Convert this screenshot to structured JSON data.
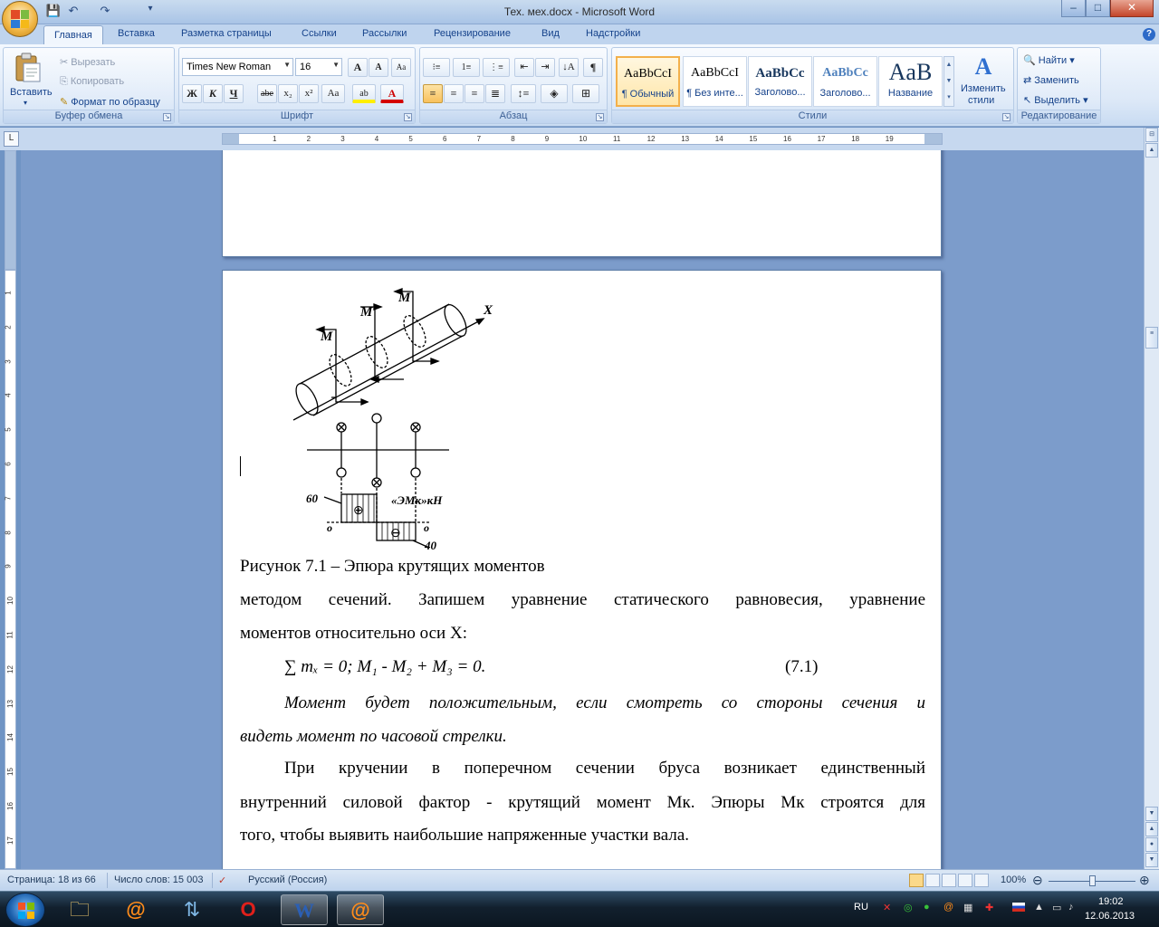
{
  "titlebar": {
    "title": "Тех. мех.docx - Microsoft Word",
    "qat_save": "💾",
    "qat_undo": "↶",
    "qat_redo": "↷",
    "qat_more": "▾",
    "min": "–",
    "max": "□",
    "close": "✕",
    "help": "?"
  },
  "tabs": [
    "Главная",
    "Вставка",
    "Разметка страницы",
    "Ссылки",
    "Рассылки",
    "Рецензирование",
    "Вид",
    "Надстройки"
  ],
  "clipboard": {
    "paste": "Вставить",
    "cut": "Вырезать",
    "copy": "Копировать",
    "format_painter": "Формат по образцу",
    "label": "Буфер обмена"
  },
  "font": {
    "name": "Times New Roman",
    "size": "16",
    "bold": "Ж",
    "italic": "К",
    "underline": "Ч",
    "strike": "abe",
    "sub": "x₂",
    "sup": "x²",
    "case": "Aa",
    "grow": "A",
    "shrink": "A",
    "clear": "Aa",
    "highlight": "ab",
    "color": "A",
    "label": "Шрифт"
  },
  "paragraph": {
    "label": "Абзац",
    "pilcrow": "¶"
  },
  "styles": {
    "items": [
      {
        "sample": "AaBbCcI",
        "name": "¶ Обычный"
      },
      {
        "sample": "AaBbCcI",
        "name": "¶ Без инте..."
      },
      {
        "sample": "AaBbCc",
        "name": "Заголово..."
      },
      {
        "sample": "AaBbCc",
        "name": "Заголово..."
      },
      {
        "sample": "AaB",
        "name": "Название"
      }
    ],
    "change": "Изменить",
    "change2": "стили",
    "label": "Стили"
  },
  "editing": {
    "find": "Найти",
    "replace": "Заменить",
    "select": "Выделить",
    "label": "Редактирование"
  },
  "ruler": {
    "marks": [
      "1",
      "2",
      "3",
      "4",
      "5",
      "6",
      "7",
      "8",
      "9",
      "10",
      "11",
      "12",
      "13",
      "14",
      "15",
      "16",
      "17",
      "18",
      "19"
    ],
    "vmarks": [
      "1",
      "2",
      "3",
      "4",
      "5",
      "6",
      "7",
      "8",
      "9",
      "10",
      "11",
      "12",
      "13",
      "14",
      "15",
      "16",
      "17"
    ]
  },
  "figure": {
    "m1": "M",
    "m2": "M",
    "m3": "M",
    "axis": "X",
    "v60": "60",
    "v40": "40",
    "zero1": "o",
    "zero2": "o",
    "diagram_label": "«ЭМк»кН",
    "plus": "⊕",
    "minus": "⊖"
  },
  "document": {
    "caption": "Рисунок 7.1 – Эпюра крутящих моментов",
    "line1": "методом сечений. Запишем уравнение статического равновесия, уравнение",
    "line2": "моментов относительно оси X:",
    "equation": "∑ mₓ = 0;  M₁ - M₂ + M₃ = 0.",
    "eq_number": "(7.1)",
    "italic1": "Момент будет положительным, если смотреть со стороны сечения и",
    "italic2": "видеть момент по часовой стрелки.",
    "para1": "При кручении в поперечном сечении бруса возникает единственный",
    "para2": "внутренний силовой фактор -  крутящий момент Мк.  Эпюры Мк строятся для",
    "para3": "того, чтобы выявить наибольшие напряженные участки вала."
  },
  "status": {
    "page": "Страница: 18 из 66",
    "words": "Число слов: 15 003",
    "lang": "Русский (Россия)",
    "zoom": "100%",
    "zoom_out": "⊖",
    "zoom_in": "⊕"
  },
  "taskbar": {
    "lang": "RU",
    "time": "19:02",
    "date": "12.06.2013"
  }
}
